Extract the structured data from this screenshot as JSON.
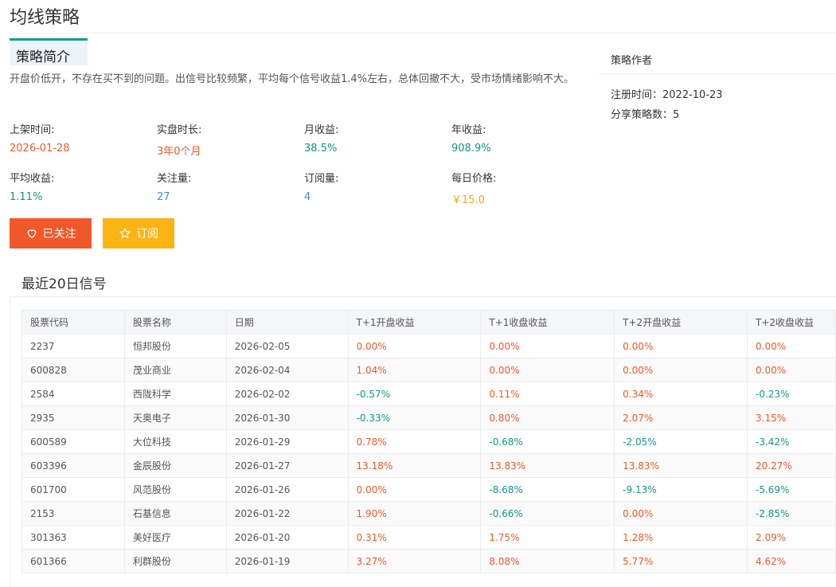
{
  "page": {
    "title": "均线策略"
  },
  "intro": {
    "tab_label": "策略简介",
    "description": "开盘价低开，不存在买不到的问题。出信号比较频繁，平均每个信号收益1.4%左右，总体回撤不大，受市场情绪影响不大。"
  },
  "stats": [
    {
      "label": "上架时间:",
      "value": "2026-01-28",
      "color": "#ee5a2b"
    },
    {
      "label": "实盘时长:",
      "value": "3年0个月",
      "color": "#ee5a2b"
    },
    {
      "label": "月收益:",
      "value": "38.5%",
      "color": "#12958a"
    },
    {
      "label": "年收益:",
      "value": "908.9%",
      "color": "#12958a"
    },
    {
      "label": "平均收益:",
      "value": "1.11%",
      "color": "#12958a"
    },
    {
      "label": "关注量:",
      "value": "27",
      "color": "#3a93d8"
    },
    {
      "label": "订阅量:",
      "value": "4",
      "color": "#3a93d8"
    },
    {
      "label": "每日价格:",
      "value": "￥15.0",
      "color": "#f2a716"
    }
  ],
  "buttons": {
    "follow_label": "已关注",
    "subscribe_label": "订阅",
    "follow_color": "#f0582a",
    "subscribe_color": "#fbb413"
  },
  "author": {
    "header": "策略作者",
    "register_label": "注册时间：",
    "register_date": "2022-10-23",
    "shared_label": "分享策略数：",
    "shared_count": "5"
  },
  "signals": {
    "title": "最近20日信号",
    "columns": [
      "股票代码",
      "股票名称",
      "日期",
      "T+1开盘收益",
      "T+1收盘收益",
      "T+2开盘收益",
      "T+2收盘收益"
    ],
    "rows": [
      [
        "2237",
        "恒邦股份",
        "2026-02-05",
        "0.00%",
        "0.00%",
        "0.00%",
        "0.00%"
      ],
      [
        "600828",
        "茂业商业",
        "2026-02-04",
        "1.04%",
        "0.00%",
        "0.00%",
        "0.00%"
      ],
      [
        "2584",
        "西陇科学",
        "2026-02-02",
        "-0.57%",
        "0.11%",
        "0.34%",
        "-0.23%"
      ],
      [
        "2935",
        "天奥电子",
        "2026-01-30",
        "-0.33%",
        "0.80%",
        "2.07%",
        "3.15%"
      ],
      [
        "600589",
        "大位科技",
        "2026-01-29",
        "0.78%",
        "-0.68%",
        "-2.05%",
        "-3.42%"
      ],
      [
        "603396",
        "金辰股份",
        "2026-01-27",
        "13.18%",
        "13.83%",
        "13.83%",
        "20.27%"
      ],
      [
        "601700",
        "风范股份",
        "2026-01-26",
        "0.00%",
        "-8.68%",
        "-9.13%",
        "-5.69%"
      ],
      [
        "2153",
        "石基信息",
        "2026-01-22",
        "1.90%",
        "-0.66%",
        "0.00%",
        "-2.85%"
      ],
      [
        "301363",
        "美好医疗",
        "2026-01-20",
        "0.31%",
        "1.75%",
        "1.28%",
        "2.09%"
      ],
      [
        "601366",
        "利群股份",
        "2026-01-19",
        "3.27%",
        "8.08%",
        "5.77%",
        "4.62%"
      ]
    ]
  },
  "colors": {
    "positive": "#ee5a2b",
    "negative": "#12958a",
    "accent": "#12a183"
  }
}
